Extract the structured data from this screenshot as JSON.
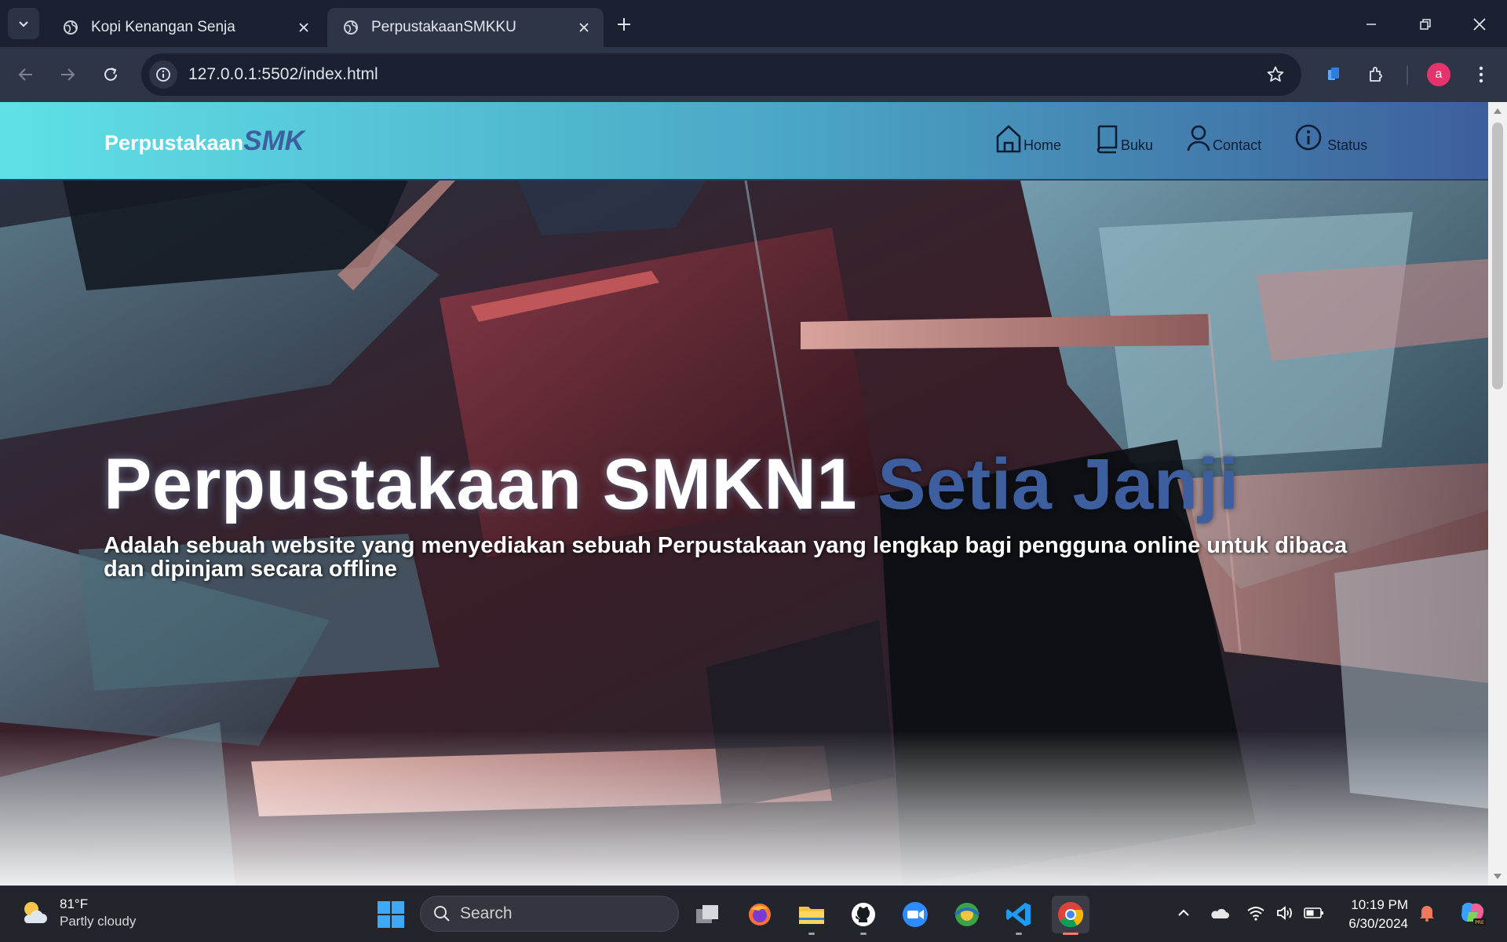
{
  "browser": {
    "tabs": [
      {
        "title": "Kopi Kenangan Senja",
        "active": false
      },
      {
        "title": "PerpustakaanSMKKU",
        "active": true
      }
    ],
    "url": "127.0.0.1:5502/index.html",
    "profile_initial": "a"
  },
  "site": {
    "logo_main": "Perpustakaan",
    "logo_accent": "SMK",
    "nav": [
      {
        "label": "Home",
        "icon": "home-icon"
      },
      {
        "label": "Buku",
        "icon": "book-icon"
      },
      {
        "label": "Contact",
        "icon": "user-icon"
      },
      {
        "label": "Status",
        "icon": "info-icon"
      }
    ],
    "hero": {
      "title_main": "Perpustakaan SMKN1",
      "title_accent": "Setia Janji",
      "description": "Adalah sebuah website yang menyediakan sebuah Perpustakaan yang lengkap bagi pengguna online untuk dibaca dan dipinjam secara offline"
    }
  },
  "taskbar": {
    "weather_temp": "81°F",
    "weather_condition": "Partly cloudy",
    "search_placeholder": "Search",
    "time": "10:19 PM",
    "date": "6/30/2024"
  },
  "colors": {
    "nav_gradient_start": "#5fe0e6",
    "nav_gradient_end": "#3d5f9c",
    "accent_blue": "#3d5fa0"
  }
}
